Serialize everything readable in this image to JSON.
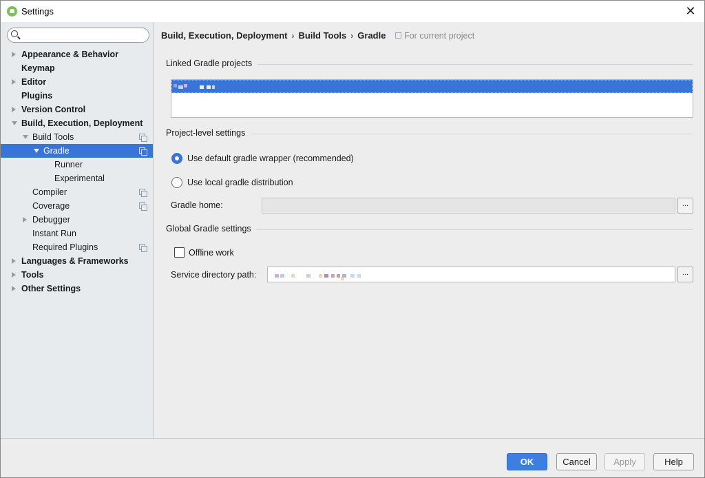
{
  "window": {
    "title": "Settings"
  },
  "search": {
    "placeholder": "",
    "value": ""
  },
  "tree": [
    {
      "label": "Appearance & Behavior",
      "level": 0,
      "arrow": "right",
      "bold": true,
      "icon": false,
      "selected": false
    },
    {
      "label": "Keymap",
      "level": 0,
      "arrow": "none",
      "bold": true,
      "icon": false,
      "selected": false
    },
    {
      "label": "Editor",
      "level": 0,
      "arrow": "right",
      "bold": true,
      "icon": false,
      "selected": false
    },
    {
      "label": "Plugins",
      "level": 0,
      "arrow": "none",
      "bold": true,
      "icon": false,
      "selected": false
    },
    {
      "label": "Version Control",
      "level": 0,
      "arrow": "right",
      "bold": true,
      "icon": false,
      "selected": false
    },
    {
      "label": "Build, Execution, Deployment",
      "level": 0,
      "arrow": "down",
      "bold": true,
      "icon": false,
      "selected": false
    },
    {
      "label": "Build Tools",
      "level": 1,
      "arrow": "down",
      "bold": false,
      "icon": true,
      "selected": false
    },
    {
      "label": "Gradle",
      "level": 2,
      "arrow": "down",
      "bold": false,
      "icon": true,
      "selected": true
    },
    {
      "label": "Runner",
      "level": 3,
      "arrow": "none",
      "bold": false,
      "icon": false,
      "selected": false
    },
    {
      "label": "Experimental",
      "level": 3,
      "arrow": "none",
      "bold": false,
      "icon": false,
      "selected": false
    },
    {
      "label": "Compiler",
      "level": 1,
      "arrow": "none",
      "bold": false,
      "icon": true,
      "selected": false
    },
    {
      "label": "Coverage",
      "level": 1,
      "arrow": "none",
      "bold": false,
      "icon": true,
      "selected": false
    },
    {
      "label": "Debugger",
      "level": 1,
      "arrow": "right",
      "bold": false,
      "icon": false,
      "selected": false
    },
    {
      "label": "Instant Run",
      "level": 1,
      "arrow": "none",
      "bold": false,
      "icon": false,
      "selected": false
    },
    {
      "label": "Required Plugins",
      "level": 1,
      "arrow": "none",
      "bold": false,
      "icon": true,
      "selected": false
    },
    {
      "label": "Languages & Frameworks",
      "level": 0,
      "arrow": "right",
      "bold": true,
      "icon": false,
      "selected": false
    },
    {
      "label": "Tools",
      "level": 0,
      "arrow": "right",
      "bold": true,
      "icon": false,
      "selected": false
    },
    {
      "label": "Other Settings",
      "level": 0,
      "arrow": "right",
      "bold": true,
      "icon": false,
      "selected": false
    }
  ],
  "breadcrumb": {
    "items": [
      "Build, Execution, Deployment",
      "Build Tools",
      "Gradle"
    ],
    "separator": "›",
    "scope": "For current project"
  },
  "main": {
    "linked_title": "Linked Gradle projects",
    "project_title": "Project-level settings",
    "radio_default": "Use default gradle wrapper (recommended)",
    "radio_local": "Use local gradle distribution",
    "selected_radio": "default",
    "gradle_home_label": "Gradle home:",
    "gradle_home_value": "",
    "global_title": "Global Gradle settings",
    "offline_label": "Offline work",
    "offline_checked": false,
    "service_dir_label": "Service directory path:",
    "browse_label": "..."
  },
  "footer": {
    "ok": "OK",
    "cancel": "Cancel",
    "apply": "Apply",
    "help": "Help"
  },
  "colors": {
    "selection": "#3875d7",
    "primary_button": "#3d7fe0"
  },
  "icons": {
    "close": "close-icon",
    "search": "search-icon",
    "copy": "project-scope-icon"
  }
}
